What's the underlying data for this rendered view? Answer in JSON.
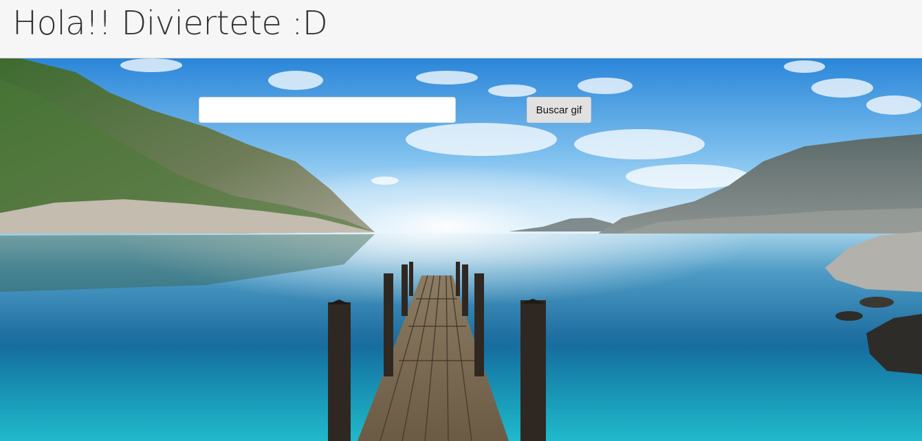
{
  "header": {
    "title": "Hola!! Diviertete :D"
  },
  "search": {
    "input_value": "",
    "placeholder": "",
    "button_label": "Buscar gif"
  },
  "background": {
    "description_icon": "lake-pier-landscape-image"
  },
  "colors": {
    "header_bg": "#f6f6f6",
    "title_text": "#333333",
    "button_bg": "#e1e1e1",
    "sky_top": "#2e8fe0",
    "water": "#1f7fb0"
  }
}
